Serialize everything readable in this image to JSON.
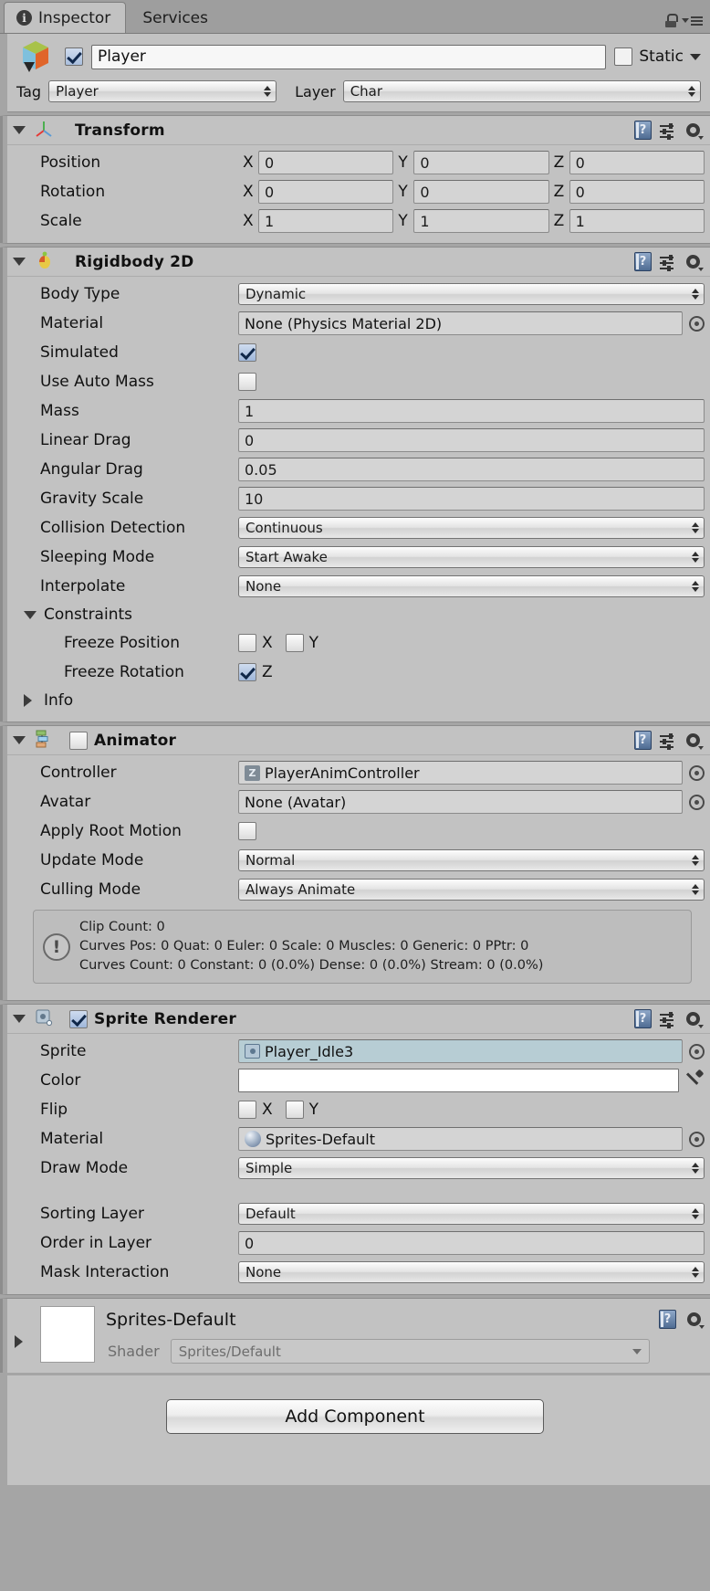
{
  "window": {
    "tabs": [
      {
        "label": "Inspector",
        "icon": "info-icon",
        "active": true
      },
      {
        "label": "Services",
        "icon": null,
        "active": false
      }
    ],
    "lock_icon": "lock-icon",
    "menu_icon": "hamburger-menu-icon"
  },
  "object_header": {
    "icon": "prefab-cube-icon",
    "enabled": true,
    "name": "Player",
    "static_label": "Static",
    "tag_label": "Tag",
    "tag_value": "Player",
    "layer_label": "Layer",
    "layer_value": "Char"
  },
  "components": [
    {
      "id": "transform",
      "title": "Transform",
      "icon": "transform-axis-icon",
      "expanded": true,
      "has_enable_checkbox": false,
      "vectors": [
        {
          "label": "Position",
          "x": "0",
          "y": "0",
          "z": "0"
        },
        {
          "label": "Rotation",
          "x": "0",
          "y": "0",
          "z": "0"
        },
        {
          "label": "Scale",
          "x": "1",
          "y": "1",
          "z": "1"
        }
      ],
      "axis_labels": [
        "X",
        "Y",
        "Z"
      ]
    },
    {
      "id": "rigidbody2d",
      "title": "Rigidbody 2D",
      "icon": "rigidbody2d-icon",
      "expanded": true,
      "has_enable_checkbox": false,
      "rows": [
        {
          "label": "Body Type",
          "type": "dropdown",
          "value": "Dynamic"
        },
        {
          "label": "Material",
          "type": "object",
          "value": "None (Physics Material 2D)"
        },
        {
          "label": "Simulated",
          "type": "checkbox",
          "checked": true
        },
        {
          "label": "Use Auto Mass",
          "type": "checkbox",
          "checked": false
        },
        {
          "label": "Mass",
          "type": "number",
          "value": "1"
        },
        {
          "label": "Linear Drag",
          "type": "number",
          "value": "0"
        },
        {
          "label": "Angular Drag",
          "type": "number",
          "value": "0.05"
        },
        {
          "label": "Gravity Scale",
          "type": "number",
          "value": "10"
        },
        {
          "label": "Collision Detection",
          "type": "dropdown",
          "value": "Continuous"
        },
        {
          "label": "Sleeping Mode",
          "type": "dropdown",
          "value": "Start Awake"
        },
        {
          "label": "Interpolate",
          "type": "dropdown",
          "value": "None"
        }
      ],
      "constraints": {
        "label": "Constraints",
        "expanded": true,
        "freeze_position": {
          "label": "Freeze Position",
          "x_label": "X",
          "x": false,
          "y_label": "Y",
          "y": false
        },
        "freeze_rotation": {
          "label": "Freeze Rotation",
          "z_label": "Z",
          "z": true
        }
      },
      "info_foldout": {
        "label": "Info",
        "expanded": false
      }
    },
    {
      "id": "animator",
      "title": "Animator",
      "icon": "animator-icon",
      "expanded": true,
      "has_enable_checkbox": true,
      "enabled": false,
      "rows": [
        {
          "label": "Controller",
          "type": "object-controller",
          "value": "PlayerAnimController",
          "selected": false
        },
        {
          "label": "Avatar",
          "type": "object",
          "value": "None (Avatar)"
        },
        {
          "label": "Apply Root Motion",
          "type": "checkbox",
          "checked": false
        },
        {
          "label": "Update Mode",
          "type": "dropdown",
          "value": "Normal"
        },
        {
          "label": "Culling Mode",
          "type": "dropdown",
          "value": "Always Animate"
        }
      ],
      "info_box": {
        "icon": "warning-icon",
        "lines": [
          "Clip Count: 0",
          "Curves Pos: 0 Quat: 0 Euler: 0 Scale: 0 Muscles: 0 Generic: 0 PPtr: 0",
          "Curves Count: 0 Constant: 0 (0.0%) Dense: 0 (0.0%) Stream: 0 (0.0%)"
        ]
      }
    },
    {
      "id": "spriterenderer",
      "title": "Sprite Renderer",
      "icon": "sprite-renderer-icon",
      "expanded": true,
      "has_enable_checkbox": true,
      "enabled": true,
      "rows": [
        {
          "label": "Sprite",
          "type": "object-sprite",
          "value": "Player_Idle3",
          "selected": true
        },
        {
          "label": "Color",
          "type": "color",
          "value": "#FFFFFF"
        },
        {
          "label": "Flip",
          "type": "flip",
          "x_label": "X",
          "x": false,
          "y_label": "Y",
          "y": false
        },
        {
          "label": "Material",
          "type": "object-material",
          "value": "Sprites-Default"
        },
        {
          "label": "Draw Mode",
          "type": "dropdown",
          "value": "Simple"
        },
        {
          "label": "",
          "type": "spacer"
        },
        {
          "label": "Sorting Layer",
          "type": "dropdown",
          "value": "Default"
        },
        {
          "label": "Order in Layer",
          "type": "number",
          "value": "0"
        },
        {
          "label": "Mask Interaction",
          "type": "dropdown",
          "value": "None"
        }
      ]
    }
  ],
  "material_editor": {
    "name": "Sprites-Default",
    "shader_label": "Shader",
    "shader_value": "Sprites/Default",
    "preview_color": "#FFFFFF"
  },
  "footer": {
    "add_component_label": "Add Component"
  }
}
